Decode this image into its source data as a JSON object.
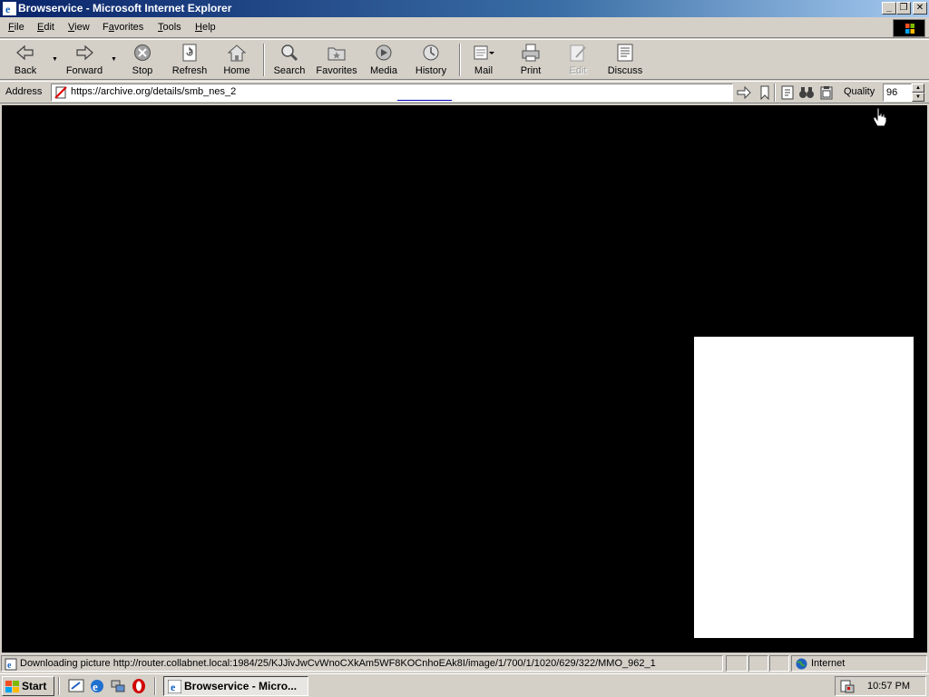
{
  "window": {
    "title": "Browservice - Microsoft Internet Explorer",
    "controls": {
      "minimize": "_",
      "maximize": "❐",
      "close": "✕"
    }
  },
  "menu": {
    "file": {
      "accel": "F",
      "rest": "ile"
    },
    "edit": {
      "accel": "E",
      "rest": "dit"
    },
    "view": {
      "accel": "V",
      "rest": "iew"
    },
    "favorites": {
      "accel": "F",
      "rest": "a",
      "rest2": "vorites"
    },
    "tools": {
      "accel": "T",
      "rest": "ools"
    },
    "help": {
      "accel": "H",
      "rest": "elp"
    }
  },
  "toolbar": {
    "back": "Back",
    "forward": "Forward",
    "stop": "Stop",
    "refresh": "Refresh",
    "home": "Home",
    "search": "Search",
    "favorites": "Favorites",
    "media": "Media",
    "history": "History",
    "mail": "Mail",
    "print": "Print",
    "edit": "Edit",
    "discuss": "Discuss"
  },
  "address": {
    "label": "Address",
    "url": "https://archive.org/details/smb_nes_2",
    "quality_label": "Quality",
    "quality_value": "96"
  },
  "status": {
    "text": "Downloading picture http://router.collabnet.local:1984/25/KJJivJwCvWnoCXkAm5WF8KOCnhoEAk8I/image/1/700/1/1020/629/322/MMO_962_1",
    "zone": "Internet"
  },
  "taskbar": {
    "start": "Start",
    "task_button": "Browservice - Micro...",
    "clock": "10:57 PM"
  },
  "colors": {
    "titlebar_start": "#0a246a",
    "titlebar_end": "#a6caf0",
    "chrome": "#d4d0c8",
    "content_background": "#000000"
  }
}
